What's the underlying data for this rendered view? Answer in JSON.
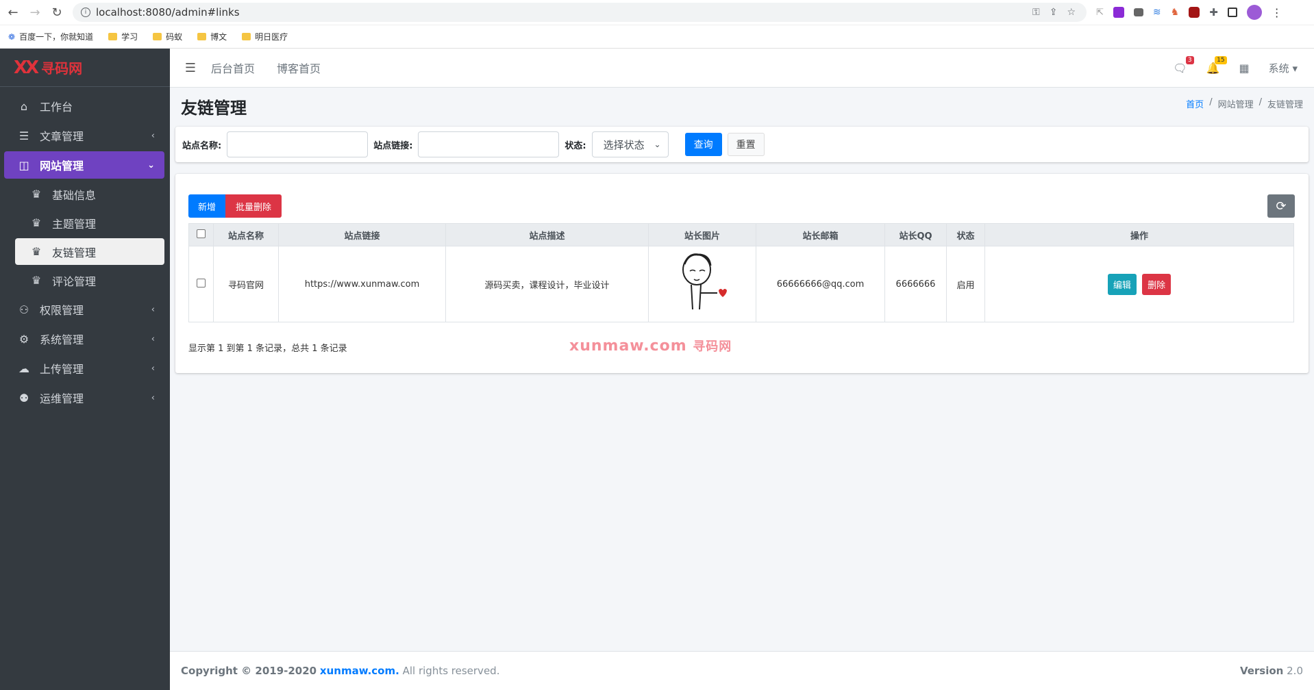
{
  "browser": {
    "url": "localhost:8080/admin#links",
    "bookmarks": [
      "百度一下，你就知道",
      "学习",
      "码蚁",
      "博文",
      "明日医疗"
    ]
  },
  "brand": {
    "logo": "XX",
    "name": "寻码网"
  },
  "sidebar": {
    "items": [
      {
        "label": "工作台",
        "icon": "home-icon"
      },
      {
        "label": "文章管理",
        "icon": "list-icon"
      },
      {
        "label": "网站管理",
        "icon": "columns-icon"
      },
      {
        "label": "权限管理",
        "icon": "user-cog-icon"
      },
      {
        "label": "系统管理",
        "icon": "gear-icon"
      },
      {
        "label": "上传管理",
        "icon": "cloud-upload-icon"
      },
      {
        "label": "运维管理",
        "icon": "people-icon"
      }
    ],
    "sub_items": [
      {
        "label": "基础信息",
        "icon": "crown-icon"
      },
      {
        "label": "主题管理",
        "icon": "crown-icon"
      },
      {
        "label": "友链管理",
        "icon": "crown-icon"
      },
      {
        "label": "评论管理",
        "icon": "crown-icon"
      }
    ]
  },
  "topbar": {
    "links": [
      "后台首页",
      "博客首页"
    ],
    "messages_count": "3",
    "notifications_count": "15",
    "system_label": "系统"
  },
  "page": {
    "title": "友链管理",
    "breadcrumb": [
      "首页",
      "网站管理",
      "友链管理"
    ]
  },
  "search": {
    "name_label": "站点名称:",
    "link_label": "站点链接:",
    "status_label": "状态:",
    "status_selected": "选择状态",
    "query_button": "查询",
    "reset_button": "重置"
  },
  "toolbar": {
    "add_label": "新增",
    "batch_delete_label": "批量删除"
  },
  "table": {
    "columns": [
      "站点名称",
      "站点链接",
      "站点描述",
      "站长图片",
      "站长邮箱",
      "站长QQ",
      "状态",
      "操作"
    ],
    "rows": [
      {
        "name": "寻码官网",
        "link": "https://www.xunmaw.com",
        "desc": "源码买卖，课程设计，毕业设计",
        "email": "66666666@qq.com",
        "qq": "6666666",
        "status": "启用",
        "edit": "编辑",
        "delete": "删除"
      }
    ],
    "summary": "显示第 1 到第 1 条记录，总共 1 条记录"
  },
  "watermark": {
    "text": "xunmaw.com",
    "cn": "寻码网"
  },
  "footer": {
    "copyright_prefix": "Copyright © 2019-2020",
    "site": "xunmaw.com.",
    "rights": "All rights reserved.",
    "version_label": "Version",
    "version": "2.0"
  }
}
